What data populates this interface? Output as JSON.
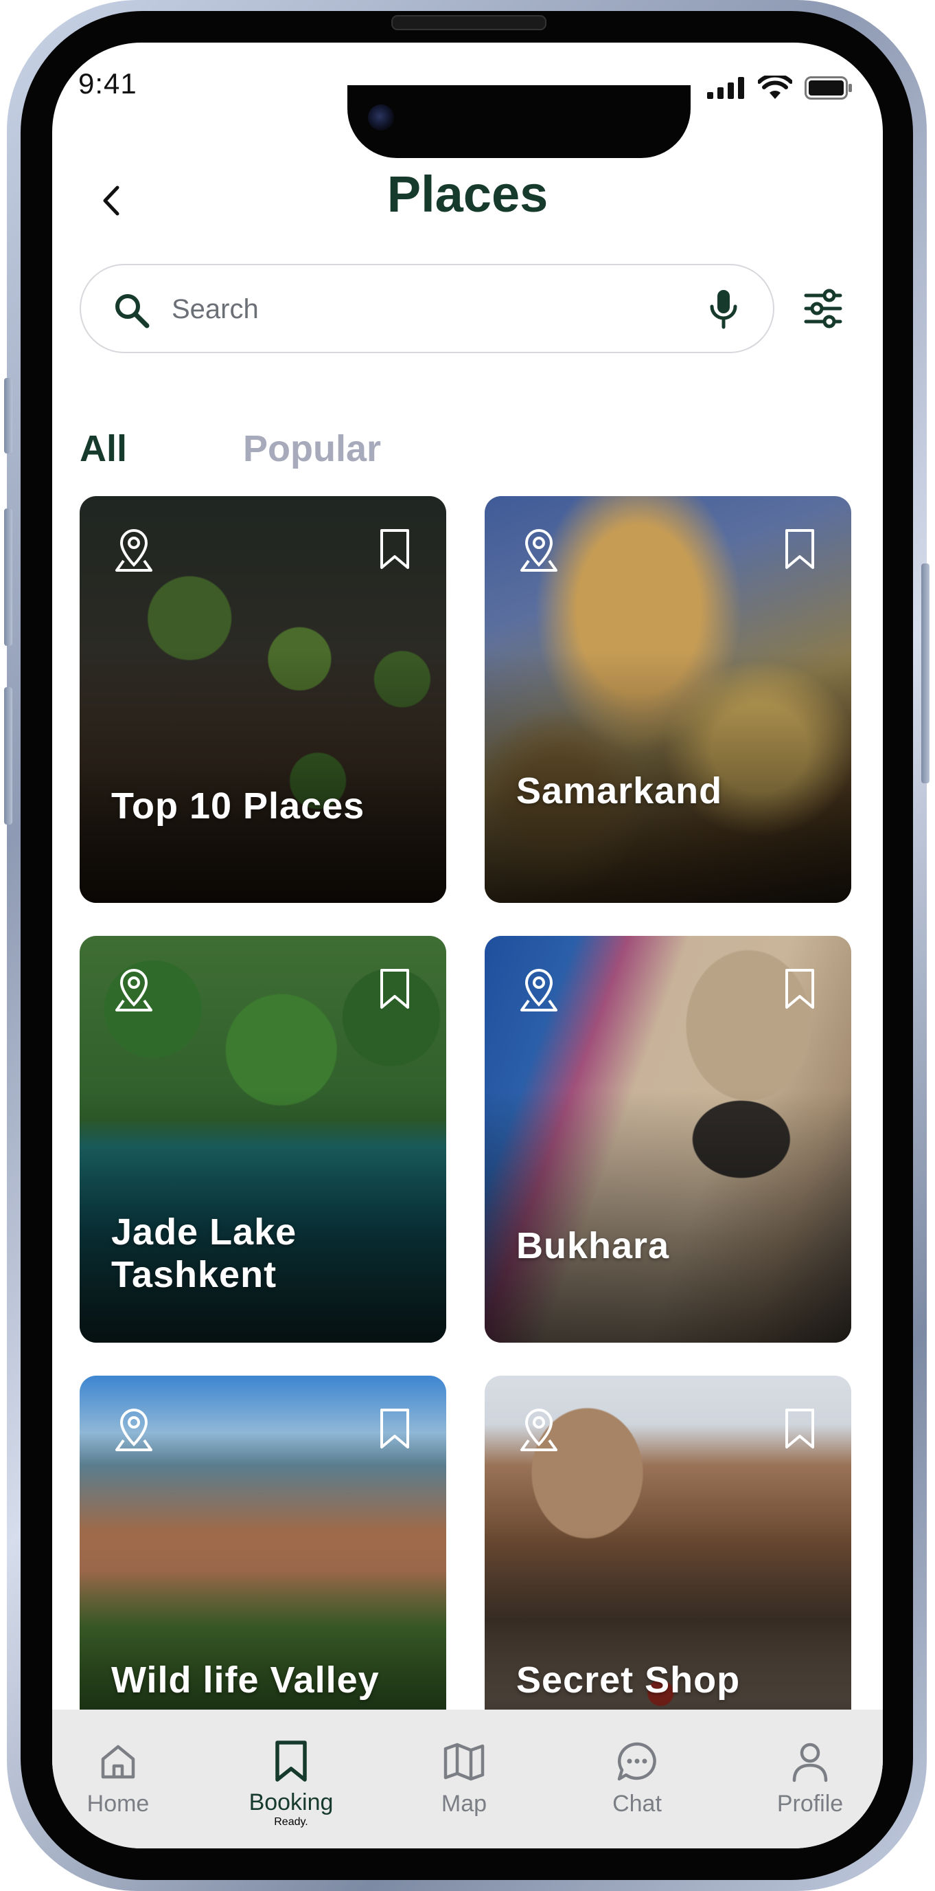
{
  "status_bar": {
    "time": "9:41"
  },
  "header": {
    "title": "Places"
  },
  "search": {
    "placeholder": "Search"
  },
  "tabs": [
    {
      "label": "All",
      "active": true
    },
    {
      "label": "Popular",
      "active": false
    }
  ],
  "places": [
    {
      "name": "Top 10 Places"
    },
    {
      "name": "Samarkand"
    },
    {
      "name": "Jade Lake Tashkent"
    },
    {
      "name": "Bukhara"
    },
    {
      "name": "Wild life Valley"
    },
    {
      "name": "Secret Shop"
    }
  ],
  "nav": [
    {
      "label": "Home",
      "icon": "home-icon",
      "active": false
    },
    {
      "label": "Booking",
      "icon": "bookmark-icon",
      "active": true
    },
    {
      "label": "Map",
      "icon": "map-icon",
      "active": false
    },
    {
      "label": "Chat",
      "icon": "chat-icon",
      "active": false
    },
    {
      "label": "Profile",
      "icon": "profile-icon",
      "active": false
    }
  ],
  "colors": {
    "primary_dark_green": "#163a2c",
    "inactive_tab": "#a7aabb",
    "nav_background": "#eaeaea"
  }
}
